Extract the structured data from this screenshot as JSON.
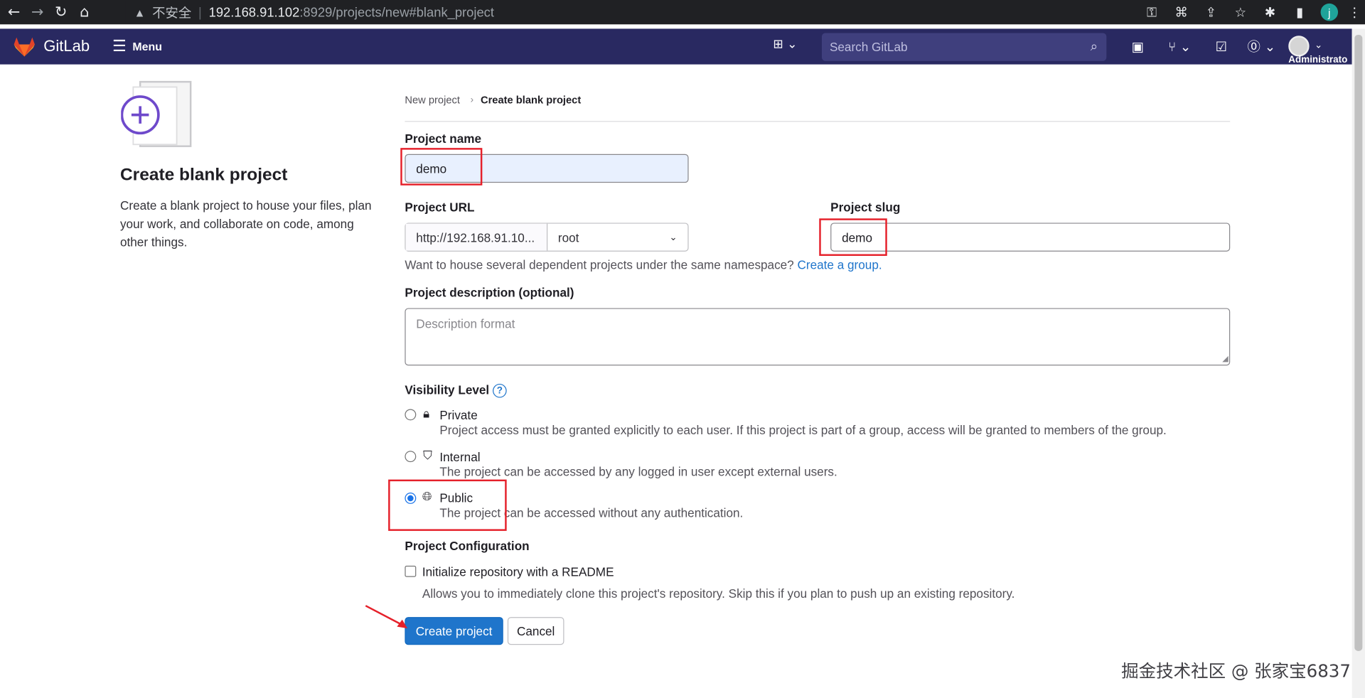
{
  "browser": {
    "security_label": "不安全",
    "url_host": "192.168.91.102",
    "url_path": ":8929/projects/new#blank_project",
    "profile_initial": "j"
  },
  "header": {
    "brand": "GitLab",
    "menu_label": "Menu",
    "search_placeholder": "Search GitLab",
    "user_label": "Administrato"
  },
  "left_panel": {
    "title": "Create blank project",
    "description": "Create a blank project to house your files, plan your work, and collaborate on code, among other things."
  },
  "breadcrumb": {
    "parent": "New project",
    "current": "Create blank project"
  },
  "form": {
    "project_name_label": "Project name",
    "project_name_value": "demo",
    "project_url_label": "Project URL",
    "project_url_prefix": "http://192.168.91.10...",
    "namespace_value": "root",
    "project_slug_label": "Project slug",
    "project_slug_value": "demo",
    "group_helper_text": "Want to house several dependent projects under the same namespace?",
    "group_helper_link": "Create a group.",
    "description_label": "Project description (optional)",
    "description_placeholder": "Description format",
    "visibility_label": "Visibility Level",
    "visibility_help": "?",
    "visibility_options": [
      {
        "title": "Private",
        "description": "Project access must be granted explicitly to each user. If this project is part of a group, access will be granted to members of the group.",
        "selected": false,
        "icon": "lock-icon"
      },
      {
        "title": "Internal",
        "description": "The project can be accessed by any logged in user except external users.",
        "selected": false,
        "icon": "shield-icon"
      },
      {
        "title": "Public",
        "description": "The project can be accessed without any authentication.",
        "selected": true,
        "icon": "globe-icon"
      }
    ],
    "config_label": "Project Configuration",
    "readme_label": "Initialize repository with a README",
    "readme_checked": false,
    "readme_help": "Allows you to immediately clone this project's repository. Skip this if you plan to push up an existing repository.",
    "create_button": "Create project",
    "cancel_button": "Cancel"
  },
  "watermark": "掘金技术社区 @ 张家宝6837",
  "colors": {
    "header_bg": "#292961",
    "primary": "#1f75cb",
    "highlight": "#e5202a"
  }
}
